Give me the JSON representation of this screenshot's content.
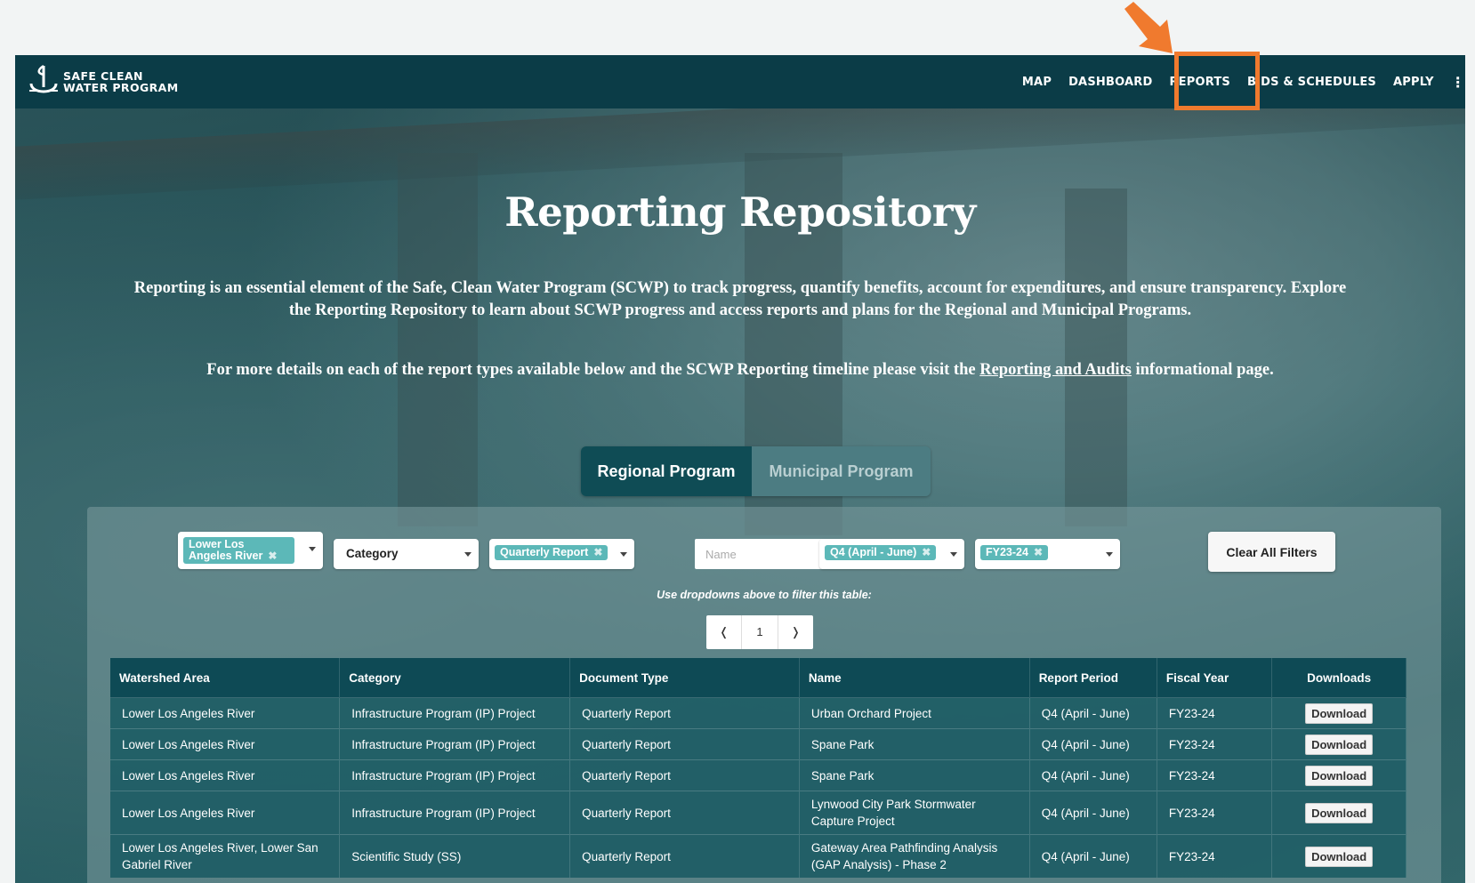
{
  "nav": {
    "logo_line1": "SAFE CLEAN",
    "logo_line2": "WATER PROGRAM",
    "links": [
      "MAP",
      "DASHBOARD",
      "REPORTS",
      "BIDS & SCHEDULES",
      "APPLY"
    ],
    "more": "⋮",
    "highlighted": "REPORTS",
    "highlight_color": "#f07a2e"
  },
  "hero": {
    "title": "Reporting Repository",
    "intro": "Reporting is an essential element of the Safe, Clean Water Program (SCWP) to track progress, quantify benefits, account for expenditures, and ensure transparency. Explore the Reporting Repository to learn about SCWP progress and access reports and plans for the Regional and Municipal Programs.",
    "more_before": "For more details on each of the report types available below and the SCWP Reporting timeline please visit the ",
    "more_link": "Reporting and Audits",
    "more_after": " informational page."
  },
  "tabs": {
    "regional": "Regional Program",
    "municipal": "Municipal Program"
  },
  "filters": {
    "watershed_chip": "Lower Los Angeles River",
    "category_label": "Category",
    "doctype_chip": "Quarterly Report",
    "name_placeholder": "Name",
    "period_chip": "Q4 (April - June)",
    "fy_chip": "FY23-24",
    "clear_label": "Clear All Filters",
    "hint": "Use dropdowns above to filter this table:"
  },
  "pager": {
    "prev": "❬",
    "page": "1",
    "next": "❭"
  },
  "table": {
    "headers": [
      "Watershed Area",
      "Category",
      "Document Type",
      "Name",
      "Report Period",
      "Fiscal Year",
      "Downloads"
    ],
    "download_label": "Download",
    "rows": [
      [
        "Lower Los Angeles River",
        "Infrastructure Program (IP) Project",
        "Quarterly Report",
        "Urban Orchard Project",
        "Q4 (April - June)",
        "FY23-24"
      ],
      [
        "Lower Los Angeles River",
        "Infrastructure Program (IP) Project",
        "Quarterly Report",
        "Spane Park",
        "Q4 (April - June)",
        "FY23-24"
      ],
      [
        "Lower Los Angeles River",
        "Infrastructure Program (IP) Project",
        "Quarterly Report",
        "Spane Park",
        "Q4 (April - June)",
        "FY23-24"
      ],
      [
        "Lower Los Angeles River",
        "Infrastructure Program (IP) Project",
        "Quarterly Report",
        "Lynwood City Park Stormwater Capture Project",
        "Q4 (April - June)",
        "FY23-24"
      ],
      [
        "Lower Los Angeles River, Lower San Gabriel River",
        "Scientific Study (SS)",
        "Quarterly Report",
        "Gateway Area Pathfinding Analysis (GAP Analysis) - Phase 2",
        "Q4 (April - June)",
        "FY23-24"
      ]
    ]
  }
}
